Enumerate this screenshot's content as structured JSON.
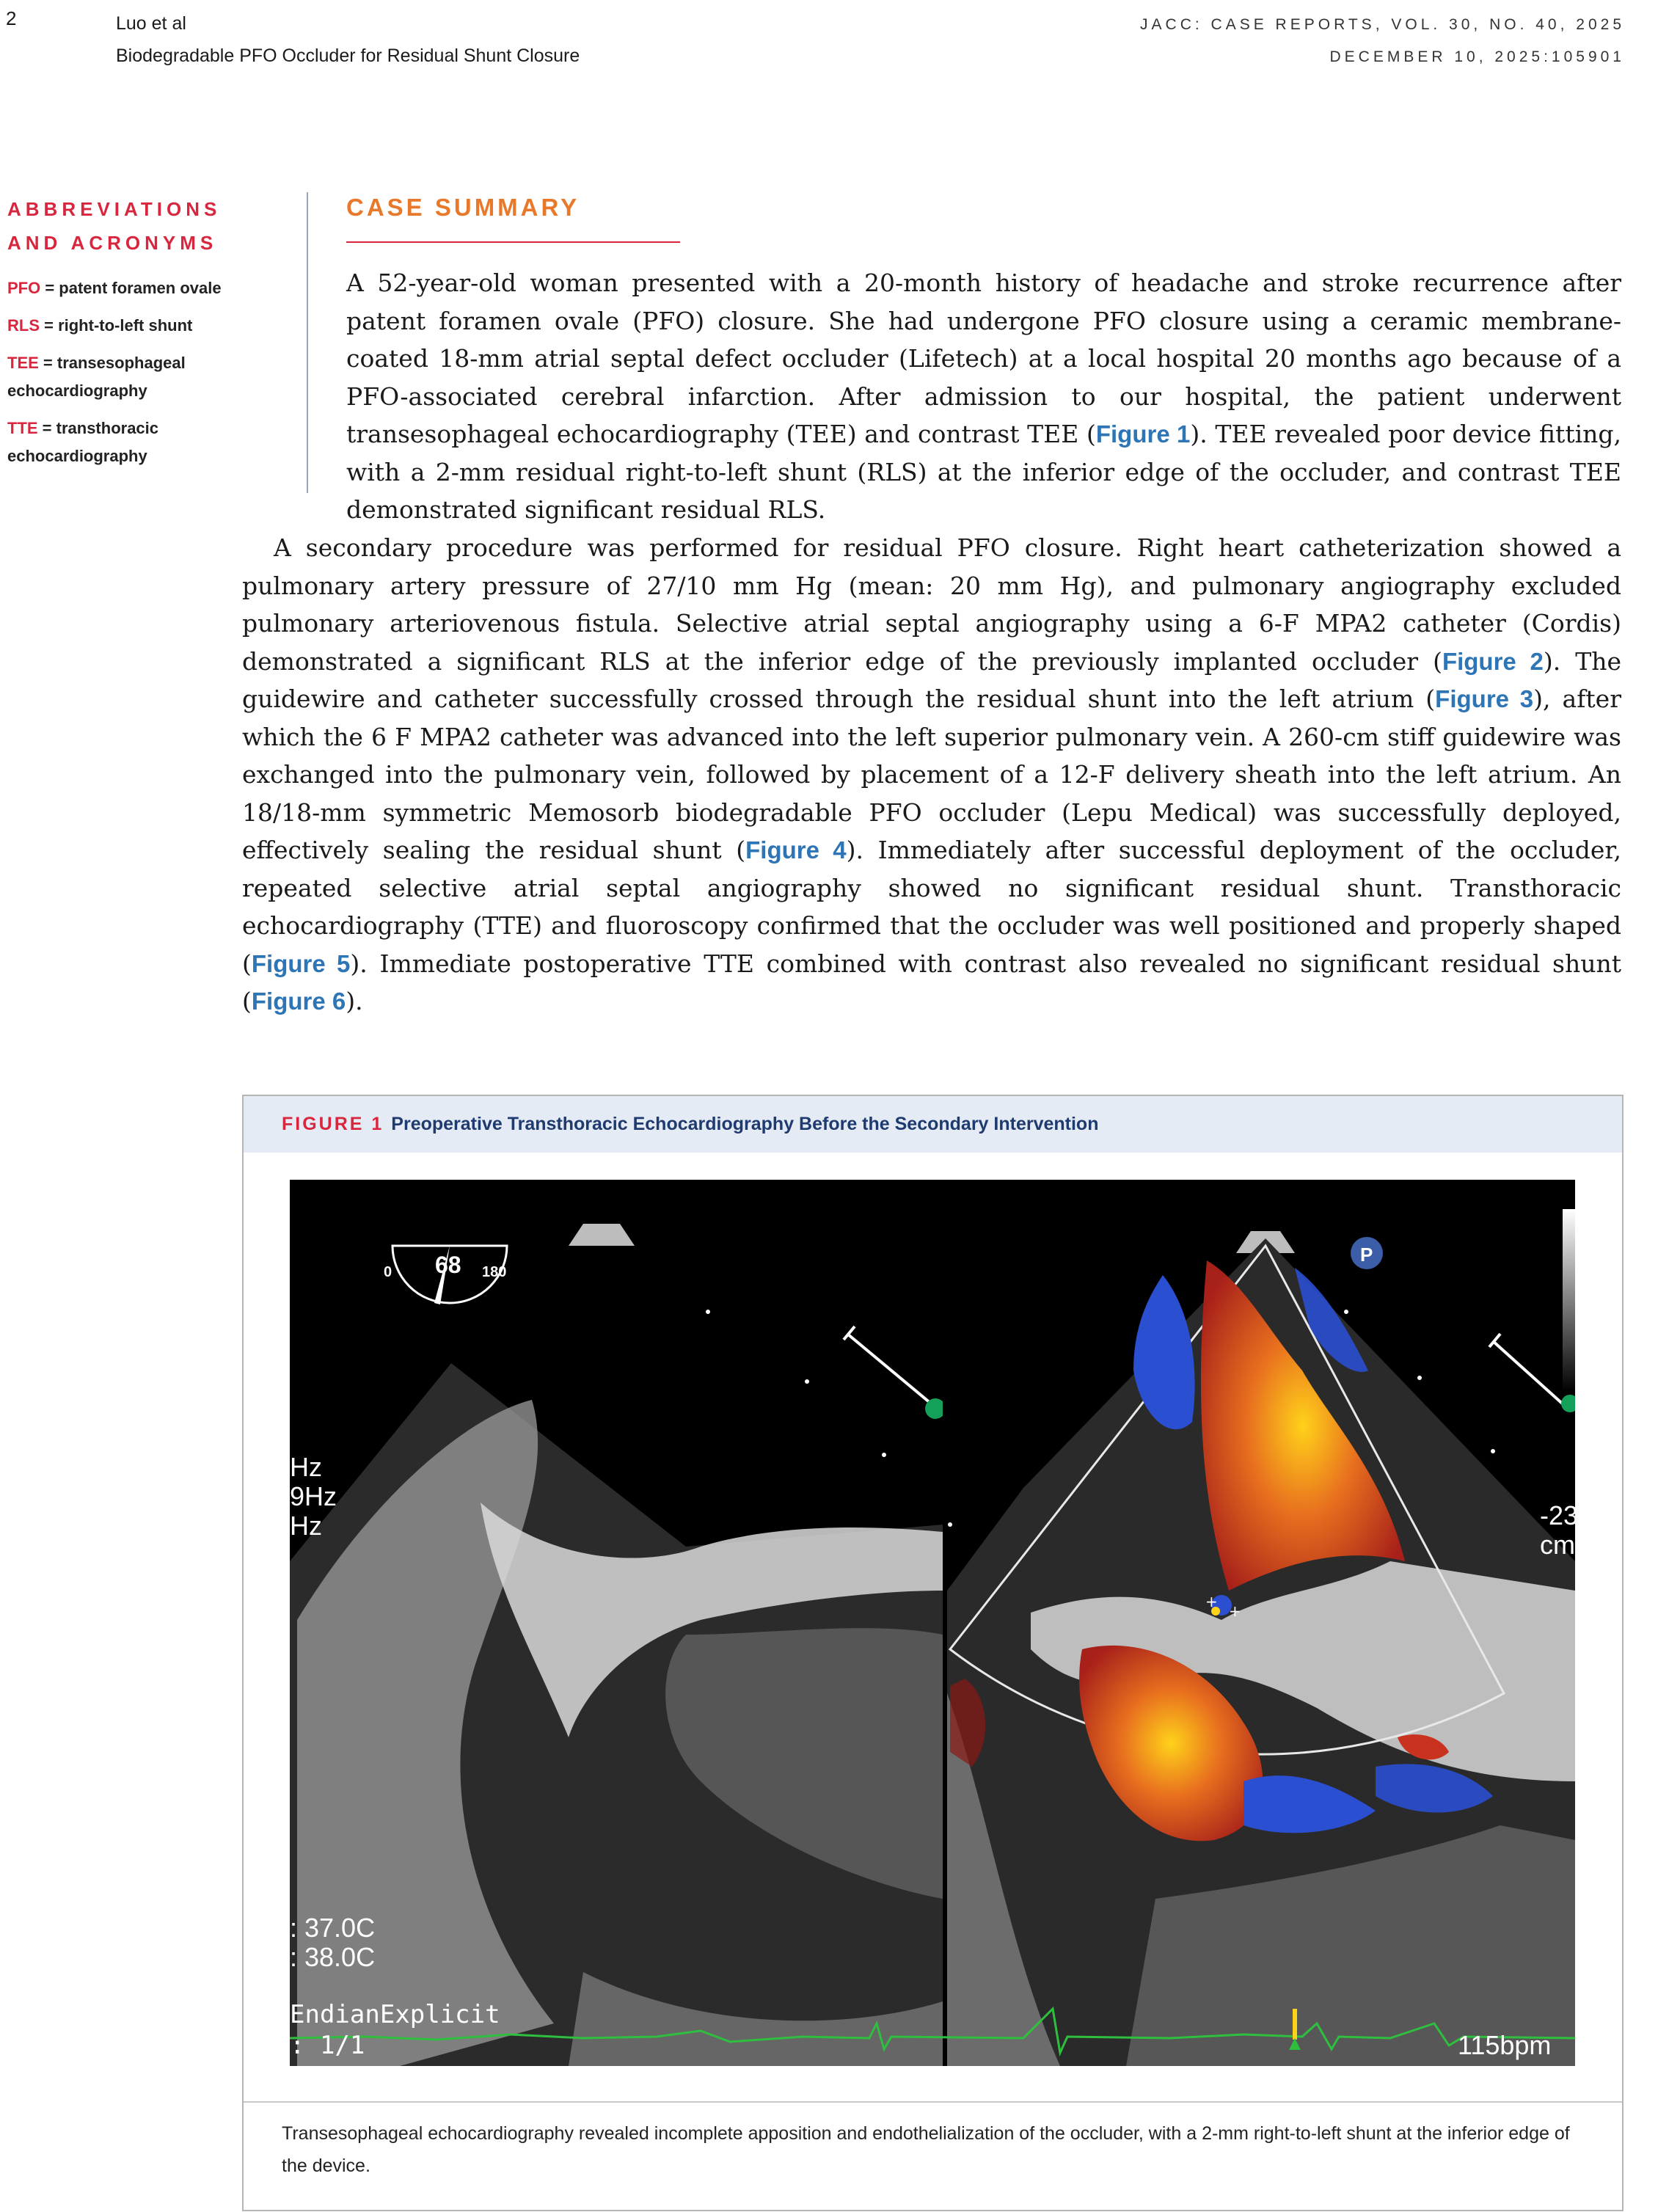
{
  "header": {
    "page_number": "2",
    "authors": "Luo et al",
    "short_title": "Biodegradable PFO Occluder for Residual Shunt Closure",
    "journal_line1": "JACC: CASE REPORTS, VOL. 30, NO. 40, 2025",
    "journal_line2": "DECEMBER 10, 2025:105901"
  },
  "abbreviations": {
    "title_line1": "ABBREVIATIONS",
    "title_line2": "AND ACRONYMS",
    "items": [
      {
        "abbr": "PFO",
        "def": " = patent foramen ovale"
      },
      {
        "abbr": "RLS",
        "def": " = right-to-left shunt"
      },
      {
        "abbr": "TEE",
        "def": " = transesophageal echocardiography"
      },
      {
        "abbr": "TTE",
        "def": " = transthoracic echocardiography"
      }
    ]
  },
  "section": {
    "title": "CASE SUMMARY"
  },
  "paragraph1": {
    "t1": "A 52-year-old woman presented with a 20-month history of headache and stroke recurrence after patent foramen ovale (PFO) closure. She had undergone PFO closure using a ceramic membrane-coated 18-mm atrial septal defect occluder (Lifetech) at a local hospital 20 months ago because of a PFO-associated cerebral infarction. After admission to our hospital, the patient underwent transesophageal echocardiography (TEE) and contrast TEE (",
    "ref1": "Figure 1",
    "t2": "). TEE revealed poor device fitting, with a 2-mm residual right-to-left shunt (RLS) at the inferior edge of the occluder, and contrast TEE demonstrated significant residual RLS."
  },
  "paragraph2": {
    "t1": "A secondary procedure was performed for residual PFO closure. Right heart catheterization showed a pulmonary artery pressure of 27/10 mm Hg (mean: 20 mm Hg), and pulmonary angiography excluded pulmonary arteriovenous fistula. Selective atrial septal angiography using a 6-F MPA2 catheter (Cordis) demonstrated a significant RLS at the inferior edge of the previously implanted occluder (",
    "ref2": "Figure 2",
    "t2": "). The guidewire and catheter successfully crossed through the residual shunt into the left atrium (",
    "ref3": "Figure 3",
    "t3": "), after which the 6 F MPA2 catheter was advanced into the left superior pulmonary vein. A 260-cm stiff guidewire was exchanged into the pulmonary vein, followed by placement of a 12-F delivery sheath into the left atrium. An 18/18-mm symmetric Memosorb biodegradable PFO occluder (Lepu Medical) was successfully deployed, effectively sealing the residual shunt (",
    "ref4": "Figure 4",
    "t4": "). Immediately after successful deployment of the occluder, repeated selective atrial septal angiography showed no significant residual shunt. Transthoracic echocardiography (TTE) and fluoroscopy confirmed that the occluder was well positioned and properly shaped (",
    "ref5": "Figure 5",
    "t5": "). Immediate postoperative TTE combined with contrast also revealed no significant residual shunt (",
    "ref6": "Figure 6",
    "t6": ")."
  },
  "figure": {
    "label": "FIGURE 1",
    "title": "Preoperative Transthoracic Echocardiography Before the Secondary Intervention",
    "caption": "Transesophageal echocardiography revealed incomplete apposition and endothelialization of the occluder, with a 2-mm right-to-left shunt at the inferior edge of the device.",
    "image_text": {
      "angle_min": "0",
      "angle_value": "68",
      "angle_max": "180",
      "freq_line1": "Hz",
      "freq_line2": "9Hz",
      "freq_line3": "Hz",
      "temp_line1": ": 37.0C",
      "temp_line2": ": 38.0C",
      "endian": "EndianExplicit",
      "frame": ": 1/1",
      "heart_rate": "115bpm",
      "depth_line1": "-23",
      "depth_line2": "cm",
      "p_marker": "P"
    },
    "colors": {
      "ecg_trace": "#2fbf3f",
      "doppler_red": "#c8321e",
      "doppler_yellow": "#ffd21a",
      "doppler_blue": "#2a4fd0"
    }
  }
}
